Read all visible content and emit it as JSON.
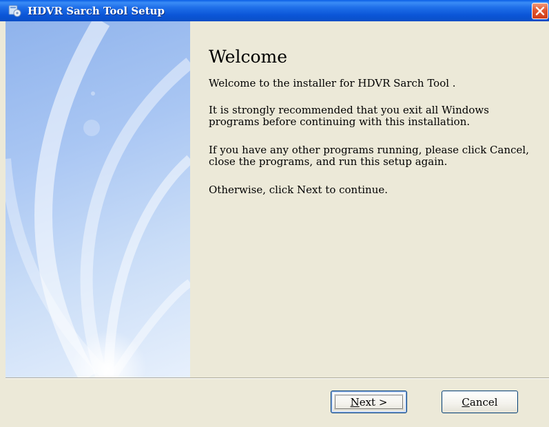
{
  "window": {
    "title": "HDVR Sarch Tool Setup",
    "close_icon": "close-icon",
    "app_icon": "setup-app-icon"
  },
  "colors": {
    "titlebar": "#0b56d8",
    "close_button": "#e0552f",
    "dialog_bg": "#ece9d8",
    "side_panel": "#a9c6f3"
  },
  "content": {
    "heading": "Welcome",
    "paragraphs": [
      "Welcome to the installer for HDVR Sarch Tool .",
      "It is strongly recommended that you exit all Windows programs before continuing with this installation.",
      "If you have any other programs running, please click Cancel, close the programs, and run this setup again.",
      "Otherwise, click Next to continue."
    ]
  },
  "buttons": {
    "next": {
      "mnemonic": "N",
      "rest": "ext >"
    },
    "cancel": {
      "mnemonic": "C",
      "rest": "ancel"
    }
  }
}
